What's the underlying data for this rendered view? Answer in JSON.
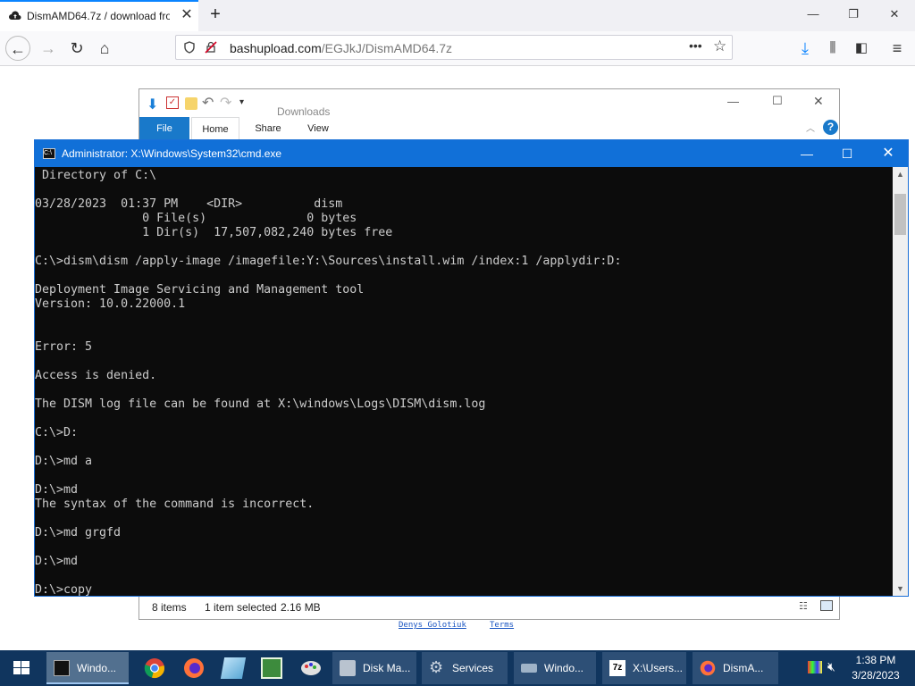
{
  "browser": {
    "tab_title": "DismAMD64.7z / download fro",
    "url_domain": "bashupload.com",
    "url_path": "/EGJkJ/DismAMD64.7z"
  },
  "explorer": {
    "title": "Downloads",
    "tabs": [
      "File",
      "Home",
      "Share",
      "View"
    ],
    "status": {
      "items": "8 items",
      "selected": "1 item selected",
      "size": "2.16 MB"
    }
  },
  "cmd": {
    "title": "Administrator: X:\\Windows\\System32\\cmd.exe",
    "lines": [
      " Directory of C:\\",
      "",
      "03/28/2023  01:37 PM    <DIR>          dism",
      "               0 File(s)              0 bytes",
      "               1 Dir(s)  17,507,082,240 bytes free",
      "",
      "C:\\>dism\\dism /apply-image /imagefile:Y:\\Sources\\install.wim /index:1 /applydir:D:",
      "",
      "Deployment Image Servicing and Management tool",
      "Version: 10.0.22000.1",
      "",
      "",
      "Error: 5",
      "",
      "Access is denied.",
      "",
      "The DISM log file can be found at X:\\windows\\Logs\\DISM\\dism.log",
      "",
      "C:\\>D:",
      "",
      "D:\\>md a",
      "",
      "D:\\>md",
      "The syntax of the command is incorrect.",
      "",
      "D:\\>md grgfd",
      "",
      "D:\\>md",
      "",
      "D:\\>copy"
    ]
  },
  "footer": {
    "author": "Denys Golotiuk",
    "terms": "Terms"
  },
  "taskbar": {
    "buttons": [
      {
        "label": "Windo...",
        "icon": "cmd-icon"
      },
      {
        "label": "Disk Ma...",
        "icon": "disk-management-icon"
      },
      {
        "label": "Services",
        "icon": "services-gear-icon"
      },
      {
        "label": "Windo...",
        "icon": "windows-setup-icon"
      },
      {
        "label": "X:\\Users...",
        "icon": "7zip-icon"
      },
      {
        "label": "DismA...",
        "icon": "firefox-icon"
      }
    ],
    "time": "1:38 PM",
    "date": "3/28/2023"
  },
  "colors": {
    "cmd_titlebar": "#1170d8",
    "console_bg": "#0c0c0c",
    "console_text": "#cccccc",
    "taskbar": "#10355e"
  }
}
